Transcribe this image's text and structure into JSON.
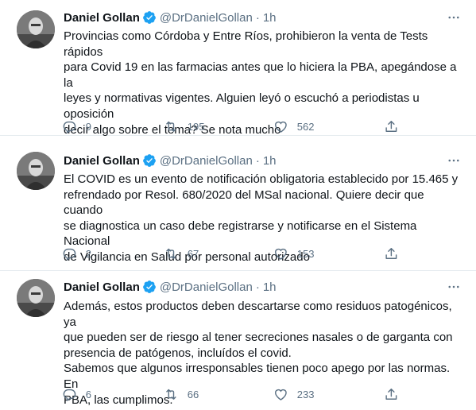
{
  "tweets": [
    {
      "author": "Daniel Gollan",
      "handle": "@DrDanielGollan",
      "separator": "·",
      "time": "1h",
      "lines": [
        "Provincias como Córdoba y Entre Ríos, prohibieron la venta de Tests rápidos",
        "para Covid 19 en las farmacias antes que lo hiciera la PBA, apegándose a la",
        "leyes y normativas vigentes. Alguien leyó o escuchó a periodistas u",
        "oposición",
        "decir algo sobre el tema? Se nota mucho"
      ],
      "replies": "9",
      "retweets": "195",
      "likes": "562"
    },
    {
      "author": "Daniel Gollan",
      "handle": "@DrDanielGollan",
      "separator": "·",
      "time": "1h",
      "lines": [
        "El COVID es un evento de notificación obligatoria establecido por 15.465 y",
        "refrendado por Resol. 680/2020 del MSal nacional. Quiere decir que cuando",
        "se diagnostica un caso debe registrarse y notificarse en el Sistema Nacional",
        "de Vigilancia en Salud por personal autorizado"
      ],
      "replies": "2",
      "retweets": "67",
      "likes": "153"
    },
    {
      "author": "Daniel Gollan",
      "handle": "@DrDanielGollan",
      "separator": "·",
      "time": "1h",
      "lines": [
        "Además, estos productos deben descartarse como residuos patogénicos, ya",
        "que pueden ser de riesgo al tener secreciones nasales o de garganta con",
        "presencia de patógenos, incluídos el covid.",
        "Sabemos que algunos irresponsables tienen poco apego por las normas. En",
        "PBA, las cumplimos."
      ],
      "replies": "6",
      "retweets": "66",
      "likes": "233"
    }
  ],
  "icons": {
    "verified": "verified-badge-icon",
    "more": "more-horizontal-icon",
    "reply": "reply-icon",
    "retweet": "retweet-icon",
    "like": "heart-icon",
    "share": "share-icon"
  },
  "colors": {
    "text": "#0f1419",
    "secondary": "#5b7083",
    "verified": "#1da1f2",
    "divider": "#e6ecf0"
  }
}
